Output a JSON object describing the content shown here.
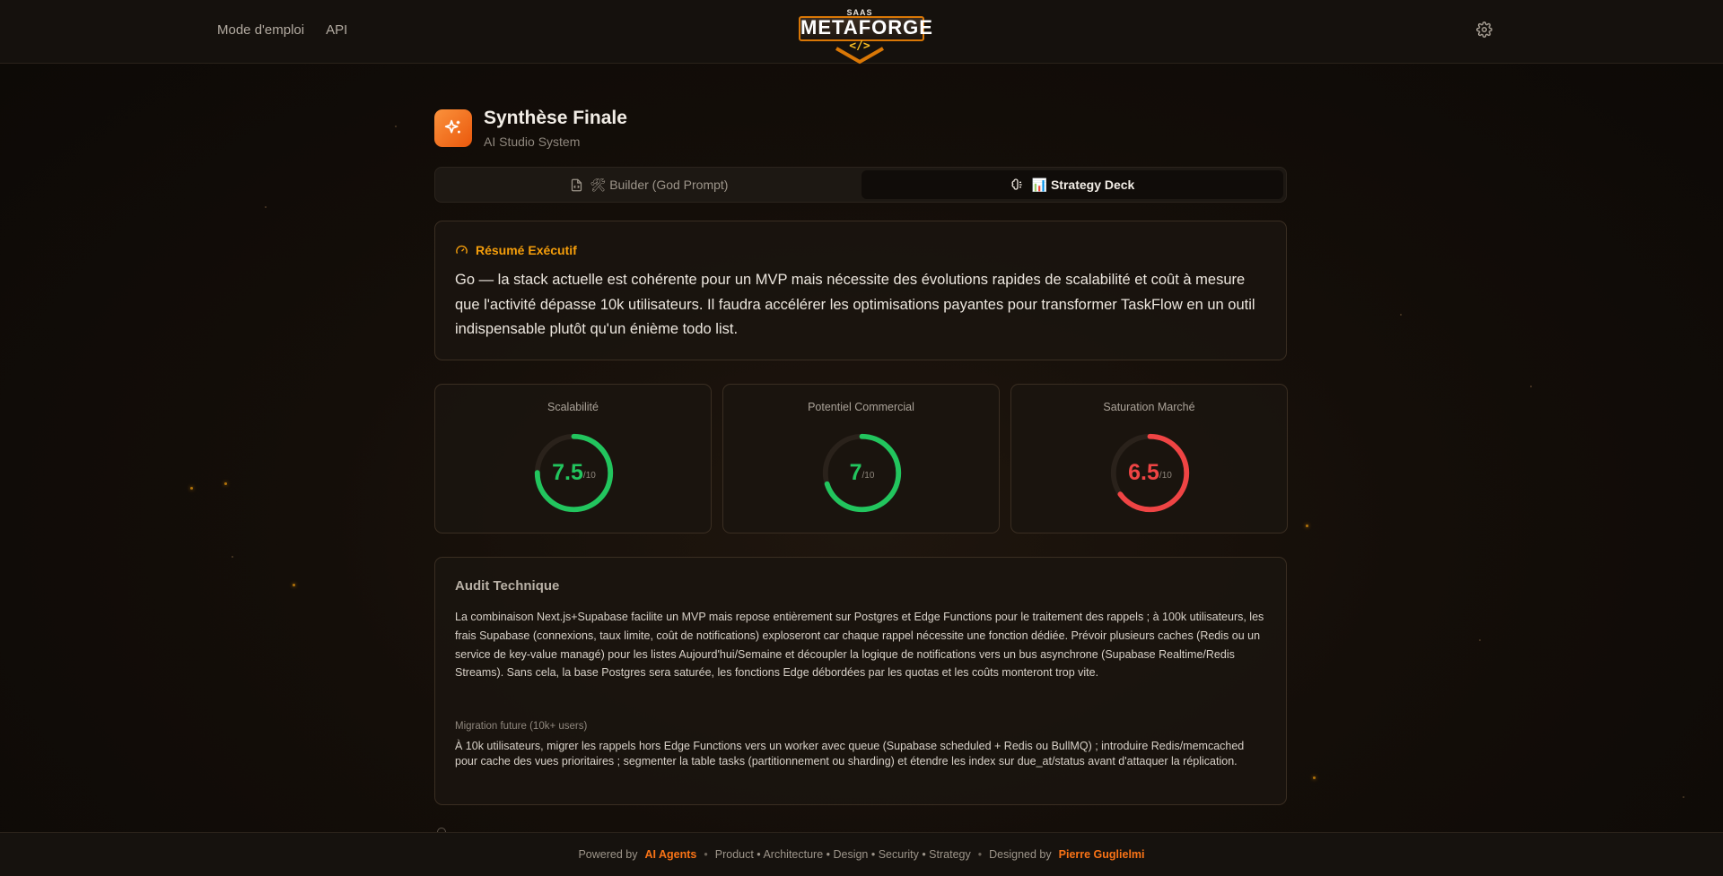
{
  "header": {
    "nav": [
      "Mode d'emploi",
      "API"
    ],
    "logo": {
      "sub": "SAAS",
      "main": "METAFORGE",
      "code": "</>"
    },
    "settings_icon": "gear-icon"
  },
  "page": {
    "title": "Synthèse Finale",
    "subtitle": "AI Studio System",
    "title_icon": "sparkles-icon"
  },
  "tabs": [
    {
      "label": "🛠 Builder (God Prompt)",
      "icon": "file-code-icon",
      "active": false
    },
    {
      "label": "📊 Strategy Deck",
      "icon": "brain-icon",
      "active": true
    }
  ],
  "summary": {
    "heading": "Résumé Exécutif",
    "icon": "gauge-icon",
    "text": "Go — la stack actuelle est cohérente pour un MVP mais nécessite des évolutions rapides de scalabilité et coût à mesure que l'activité dépasse 10k utilisateurs. Il faudra accélérer les optimisations payantes pour transformer TaskFlow en un outil indispensable plutôt qu'un énième todo list."
  },
  "scores": [
    {
      "label": "Scalabilité",
      "value": "7.5",
      "fraction": 0.75,
      "unit": "/10",
      "color": "#22c55e"
    },
    {
      "label": "Potentiel Commercial",
      "value": "7",
      "fraction": 0.7,
      "unit": "/10",
      "color": "#22c55e"
    },
    {
      "label": "Saturation Marché",
      "value": "6.5",
      "fraction": 0.65,
      "unit": "/10",
      "color": "#ef4444"
    }
  ],
  "audit": {
    "title": "Audit Technique",
    "body": "La combinaison Next.js+Supabase facilite un MVP mais repose entièrement sur Postgres et Edge Functions pour le traitement des rappels ; à 100k utilisateurs, les frais Supabase (connexions, taux limite, coût de notifications) exploseront car chaque rappel nécessite une fonction dédiée. Prévoir plusieurs caches (Redis ou un service de key-value managé) pour les listes Aujourd'hui/Semaine et découpler la logique de notifications vers un bus asynchrone (Supabase Realtime/Redis Streams). Sans cela, la base Postgres sera saturée, les fonctions Edge débordées par les quotas et les coûts monteront trop vite.",
    "migration_label": "Migration future (10k+ users)",
    "migration_body": "À 10k utilisateurs, migrer les rappels hors Edge Functions vers un worker avec queue (Supabase scheduled + Redis ou BullMQ) ; introduire Redis/memcached pour cache des vues prioritaires ; segmenter la table tasks (partitionnement ou sharding) et étendre les index sur due_at/status avant d'attaquer la réplication."
  },
  "footer": {
    "powered_by": "Powered by",
    "agents": "AI Agents",
    "bullet": "•",
    "roles": "Product • Architecture • Design • Security • Strategy",
    "designed_by": "Designed by",
    "author": "Pierre Guglielmi"
  },
  "colors": {
    "accent": "#f97316",
    "good": "#22c55e",
    "bad": "#ef4444"
  }
}
